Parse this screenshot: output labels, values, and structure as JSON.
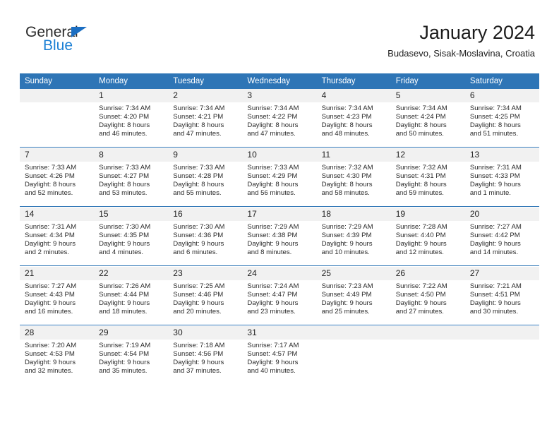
{
  "brand": {
    "logo_word_1": "General",
    "logo_word_2": "Blue",
    "logo_triangle_color": "#1b6ec2",
    "logo_blue_color": "#1b7fd4"
  },
  "header": {
    "title": "January 2024",
    "subtitle": "Budasevo, Sisak-Moslavina, Croatia"
  },
  "theme": {
    "header_row_bg": "#2e75b6",
    "daynum_bg": "#f1f1f1",
    "cell_bg": "#ffffff",
    "rule_color": "#2e75b6",
    "text_color": "#2a2a2a"
  },
  "weekday_headers": [
    "Sunday",
    "Monday",
    "Tuesday",
    "Wednesday",
    "Thursday",
    "Friday",
    "Saturday"
  ],
  "weeks": [
    [
      {
        "day": "",
        "lines": []
      },
      {
        "day": "1",
        "lines": [
          "Sunrise: 7:34 AM",
          "Sunset: 4:20 PM",
          "Daylight: 8 hours",
          "and 46 minutes."
        ]
      },
      {
        "day": "2",
        "lines": [
          "Sunrise: 7:34 AM",
          "Sunset: 4:21 PM",
          "Daylight: 8 hours",
          "and 47 minutes."
        ]
      },
      {
        "day": "3",
        "lines": [
          "Sunrise: 7:34 AM",
          "Sunset: 4:22 PM",
          "Daylight: 8 hours",
          "and 47 minutes."
        ]
      },
      {
        "day": "4",
        "lines": [
          "Sunrise: 7:34 AM",
          "Sunset: 4:23 PM",
          "Daylight: 8 hours",
          "and 48 minutes."
        ]
      },
      {
        "day": "5",
        "lines": [
          "Sunrise: 7:34 AM",
          "Sunset: 4:24 PM",
          "Daylight: 8 hours",
          "and 50 minutes."
        ]
      },
      {
        "day": "6",
        "lines": [
          "Sunrise: 7:34 AM",
          "Sunset: 4:25 PM",
          "Daylight: 8 hours",
          "and 51 minutes."
        ]
      }
    ],
    [
      {
        "day": "7",
        "lines": [
          "Sunrise: 7:33 AM",
          "Sunset: 4:26 PM",
          "Daylight: 8 hours",
          "and 52 minutes."
        ]
      },
      {
        "day": "8",
        "lines": [
          "Sunrise: 7:33 AM",
          "Sunset: 4:27 PM",
          "Daylight: 8 hours",
          "and 53 minutes."
        ]
      },
      {
        "day": "9",
        "lines": [
          "Sunrise: 7:33 AM",
          "Sunset: 4:28 PM",
          "Daylight: 8 hours",
          "and 55 minutes."
        ]
      },
      {
        "day": "10",
        "lines": [
          "Sunrise: 7:33 AM",
          "Sunset: 4:29 PM",
          "Daylight: 8 hours",
          "and 56 minutes."
        ]
      },
      {
        "day": "11",
        "lines": [
          "Sunrise: 7:32 AM",
          "Sunset: 4:30 PM",
          "Daylight: 8 hours",
          "and 58 minutes."
        ]
      },
      {
        "day": "12",
        "lines": [
          "Sunrise: 7:32 AM",
          "Sunset: 4:31 PM",
          "Daylight: 8 hours",
          "and 59 minutes."
        ]
      },
      {
        "day": "13",
        "lines": [
          "Sunrise: 7:31 AM",
          "Sunset: 4:33 PM",
          "Daylight: 9 hours",
          "and 1 minute."
        ]
      }
    ],
    [
      {
        "day": "14",
        "lines": [
          "Sunrise: 7:31 AM",
          "Sunset: 4:34 PM",
          "Daylight: 9 hours",
          "and 2 minutes."
        ]
      },
      {
        "day": "15",
        "lines": [
          "Sunrise: 7:30 AM",
          "Sunset: 4:35 PM",
          "Daylight: 9 hours",
          "and 4 minutes."
        ]
      },
      {
        "day": "16",
        "lines": [
          "Sunrise: 7:30 AM",
          "Sunset: 4:36 PM",
          "Daylight: 9 hours",
          "and 6 minutes."
        ]
      },
      {
        "day": "17",
        "lines": [
          "Sunrise: 7:29 AM",
          "Sunset: 4:38 PM",
          "Daylight: 9 hours",
          "and 8 minutes."
        ]
      },
      {
        "day": "18",
        "lines": [
          "Sunrise: 7:29 AM",
          "Sunset: 4:39 PM",
          "Daylight: 9 hours",
          "and 10 minutes."
        ]
      },
      {
        "day": "19",
        "lines": [
          "Sunrise: 7:28 AM",
          "Sunset: 4:40 PM",
          "Daylight: 9 hours",
          "and 12 minutes."
        ]
      },
      {
        "day": "20",
        "lines": [
          "Sunrise: 7:27 AM",
          "Sunset: 4:42 PM",
          "Daylight: 9 hours",
          "and 14 minutes."
        ]
      }
    ],
    [
      {
        "day": "21",
        "lines": [
          "Sunrise: 7:27 AM",
          "Sunset: 4:43 PM",
          "Daylight: 9 hours",
          "and 16 minutes."
        ]
      },
      {
        "day": "22",
        "lines": [
          "Sunrise: 7:26 AM",
          "Sunset: 4:44 PM",
          "Daylight: 9 hours",
          "and 18 minutes."
        ]
      },
      {
        "day": "23",
        "lines": [
          "Sunrise: 7:25 AM",
          "Sunset: 4:46 PM",
          "Daylight: 9 hours",
          "and 20 minutes."
        ]
      },
      {
        "day": "24",
        "lines": [
          "Sunrise: 7:24 AM",
          "Sunset: 4:47 PM",
          "Daylight: 9 hours",
          "and 23 minutes."
        ]
      },
      {
        "day": "25",
        "lines": [
          "Sunrise: 7:23 AM",
          "Sunset: 4:49 PM",
          "Daylight: 9 hours",
          "and 25 minutes."
        ]
      },
      {
        "day": "26",
        "lines": [
          "Sunrise: 7:22 AM",
          "Sunset: 4:50 PM",
          "Daylight: 9 hours",
          "and 27 minutes."
        ]
      },
      {
        "day": "27",
        "lines": [
          "Sunrise: 7:21 AM",
          "Sunset: 4:51 PM",
          "Daylight: 9 hours",
          "and 30 minutes."
        ]
      }
    ],
    [
      {
        "day": "28",
        "lines": [
          "Sunrise: 7:20 AM",
          "Sunset: 4:53 PM",
          "Daylight: 9 hours",
          "and 32 minutes."
        ]
      },
      {
        "day": "29",
        "lines": [
          "Sunrise: 7:19 AM",
          "Sunset: 4:54 PM",
          "Daylight: 9 hours",
          "and 35 minutes."
        ]
      },
      {
        "day": "30",
        "lines": [
          "Sunrise: 7:18 AM",
          "Sunset: 4:56 PM",
          "Daylight: 9 hours",
          "and 37 minutes."
        ]
      },
      {
        "day": "31",
        "lines": [
          "Sunrise: 7:17 AM",
          "Sunset: 4:57 PM",
          "Daylight: 9 hours",
          "and 40 minutes."
        ]
      },
      {
        "day": "",
        "lines": []
      },
      {
        "day": "",
        "lines": []
      },
      {
        "day": "",
        "lines": []
      }
    ]
  ]
}
